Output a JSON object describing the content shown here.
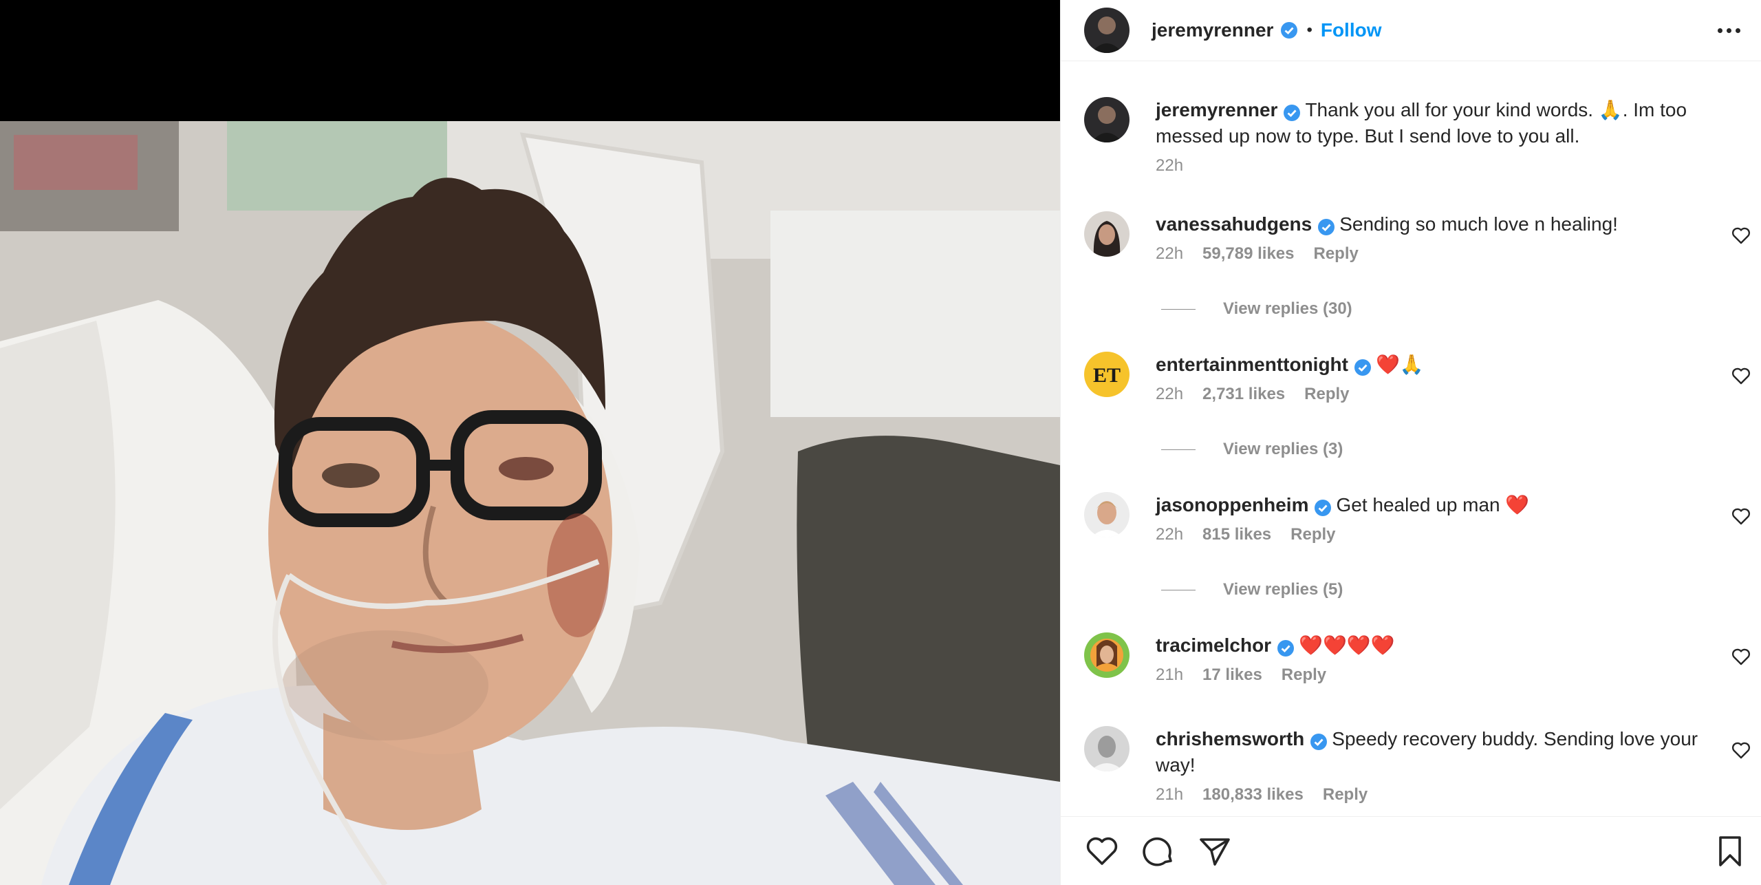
{
  "post": {
    "username": "jeremyrenner",
    "follow_label": "Follow",
    "separator": "•"
  },
  "caption": {
    "username": "jeremyrenner",
    "text": "Thank you all for your kind words. 🙏. Im too messed up now to type. But I send love to you all.",
    "time": "22h"
  },
  "comments": [
    {
      "username": "vanessahudgens",
      "text": "Sending so much love n healing!",
      "time": "22h",
      "likes": "59,789 likes",
      "reply": "Reply",
      "view_replies": "View replies (30)"
    },
    {
      "username": "entertainmenttonight",
      "text": "❤️🙏",
      "time": "22h",
      "likes": "2,731 likes",
      "reply": "Reply",
      "view_replies": "View replies (3)",
      "avatar_text": "ET"
    },
    {
      "username": "jasonoppenheim",
      "text": "Get healed up man ❤️",
      "time": "22h",
      "likes": "815 likes",
      "reply": "Reply",
      "view_replies": "View replies (5)"
    },
    {
      "username": "tracimelchor",
      "text": "❤️❤️❤️❤️",
      "time": "21h",
      "likes": "17 likes",
      "reply": "Reply"
    },
    {
      "username": "chrishemsworth",
      "text": "Speedy recovery buddy. Sending love your way!",
      "time": "21h",
      "likes": "180,833 likes",
      "reply": "Reply"
    }
  ],
  "icons": {
    "verified": "verified-badge-icon",
    "more": "more-options-icon",
    "like": "heart-icon",
    "comment": "comment-icon",
    "share": "share-icon",
    "save": "bookmark-icon"
  },
  "colors": {
    "accent": "#0095f6",
    "verified": "#3897f0",
    "muted": "#8e8e8e",
    "text": "#262626"
  }
}
